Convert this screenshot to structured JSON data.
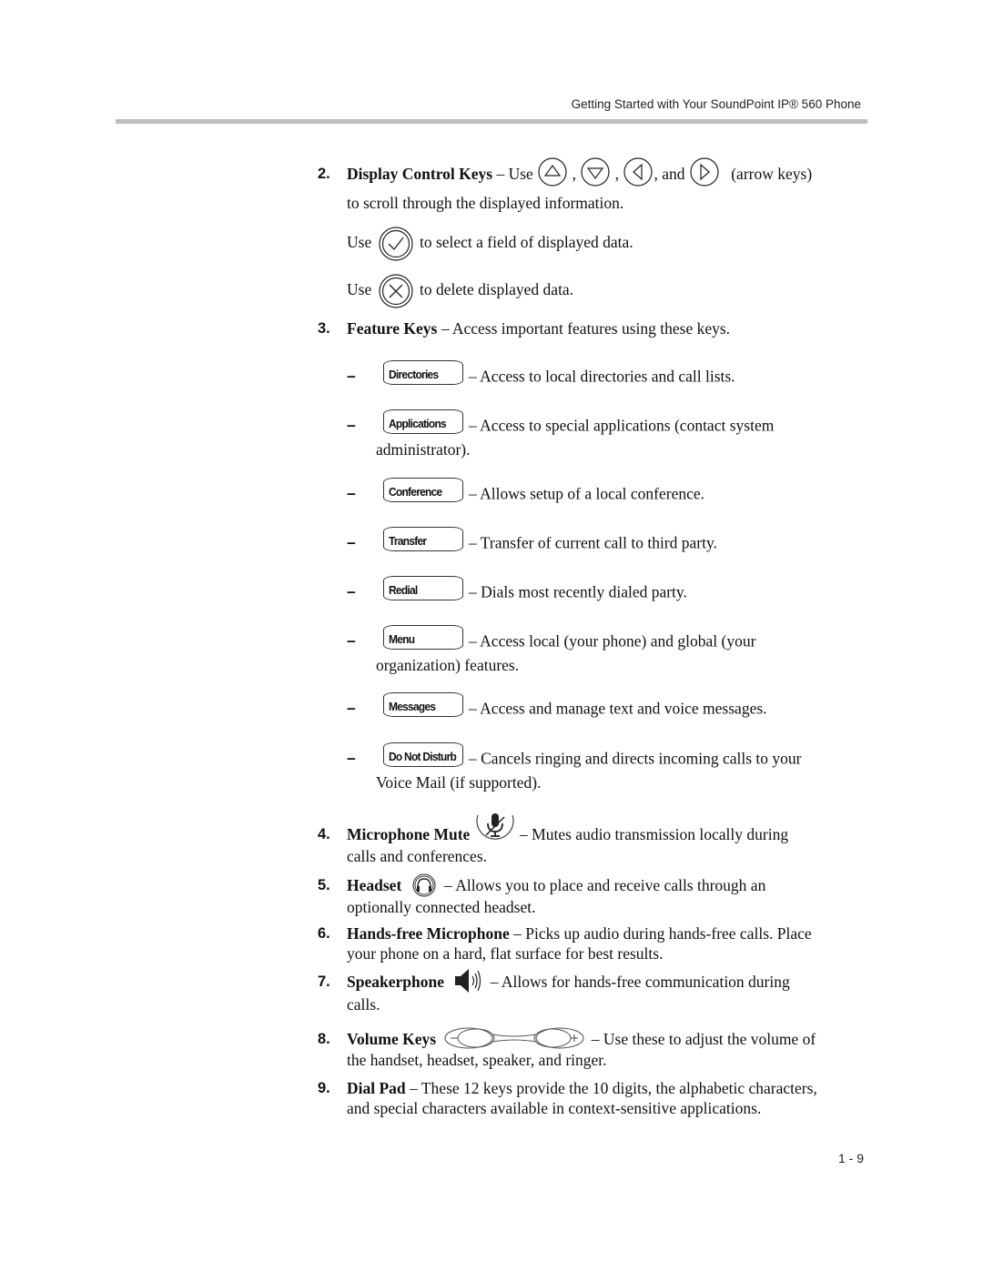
{
  "header": {
    "running_title": "Getting Started with Your SoundPoint IP® 560 Phone"
  },
  "items": {
    "display_control": {
      "number": "2.",
      "term": "Display Control Keys",
      "lead": " – Use ",
      "comma1": " , ",
      "comma2": " , ",
      "and": ", and ",
      "suffix": " (arrow keys)",
      "line2": "to scroll through the displayed information.",
      "icons": [
        "arrow-up-icon",
        "arrow-down-icon",
        "arrow-left-icon",
        "arrow-right-icon"
      ],
      "select_use": "Use",
      "select_text": "to select a field of displayed data.",
      "delete_use": "Use",
      "delete_text": "to delete displayed data."
    },
    "feature_keys": {
      "number": "3.",
      "term": "Feature Keys",
      "text": " – Access important features using these keys.",
      "keys": [
        {
          "label": "Directories",
          "desc": "– Access to local directories and call lists.",
          "cont": ""
        },
        {
          "label": "Applications",
          "desc": "– Access to special applications (contact system",
          "cont": "administrator)."
        },
        {
          "label": "Conference",
          "desc": "– Allows setup of a local conference.",
          "cont": ""
        },
        {
          "label": "Transfer",
          "desc": "– Transfer of current call to third party.",
          "cont": ""
        },
        {
          "label": "Redial",
          "desc": "– Dials most recently dialed party.",
          "cont": ""
        },
        {
          "label": "Menu",
          "desc": "– Access local (your phone) and global (your",
          "cont": "organization) features."
        },
        {
          "label": "Messages",
          "desc": "– Access and manage text and voice messages.",
          "cont": ""
        },
        {
          "label": "Do Not Disturb",
          "desc": "– Cancels ringing and directs incoming calls to your",
          "cont": "Voice Mail (if supported)."
        }
      ],
      "dash": "–"
    },
    "mic_mute": {
      "number": "4.",
      "term": "Microphone Mute",
      "text": " – Mutes audio transmission locally during",
      "line2": "calls and conferences."
    },
    "headset": {
      "number": "5.",
      "term": "Headset",
      "text": " – Allows you to place and receive calls through an",
      "line2": "optionally connected headset."
    },
    "handsfree_mic": {
      "number": "6.",
      "term": "Hands-free Microphone",
      "text": " – Picks up audio during hands-free calls. Place",
      "line2": "your phone on a hard, flat surface for best results."
    },
    "speakerphone": {
      "number": "7.",
      "term": "Speakerphone",
      "text": " – Allows for hands-free communication during",
      "line2": "calls."
    },
    "volume_keys": {
      "number": "8.",
      "term": "Volume Keys",
      "text": " – Use these to adjust the volume of",
      "line2": "the handset, headset, speaker, and ringer."
    },
    "dial_pad": {
      "number": "9.",
      "term": "Dial Pad",
      "text": " – These 12 keys provide the 10 digits, the alphabetic characters,",
      "line2": "and special characters available in context-sensitive applications."
    }
  },
  "footer": {
    "page_number": "1 - 9"
  }
}
